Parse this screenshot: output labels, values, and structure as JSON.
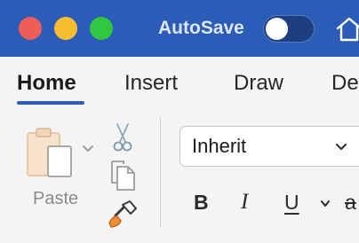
{
  "titlebar": {
    "autosave_label": "AutoSave",
    "autosave_on": false,
    "color": "#2b5cb8"
  },
  "tabs": [
    {
      "label": "Home",
      "active": true
    },
    {
      "label": "Insert",
      "active": false
    },
    {
      "label": "Draw",
      "active": false
    },
    {
      "label": "De",
      "active": false
    }
  ],
  "clipboard": {
    "paste_label": "Paste",
    "icons": [
      "clipboard-icon",
      "scissors-icon",
      "copy-icon",
      "format-painter-icon"
    ]
  },
  "font": {
    "family_value": "Inherit",
    "buttons": {
      "bold": "B",
      "italic": "I",
      "underline": "U",
      "strikethrough": "a"
    }
  }
}
